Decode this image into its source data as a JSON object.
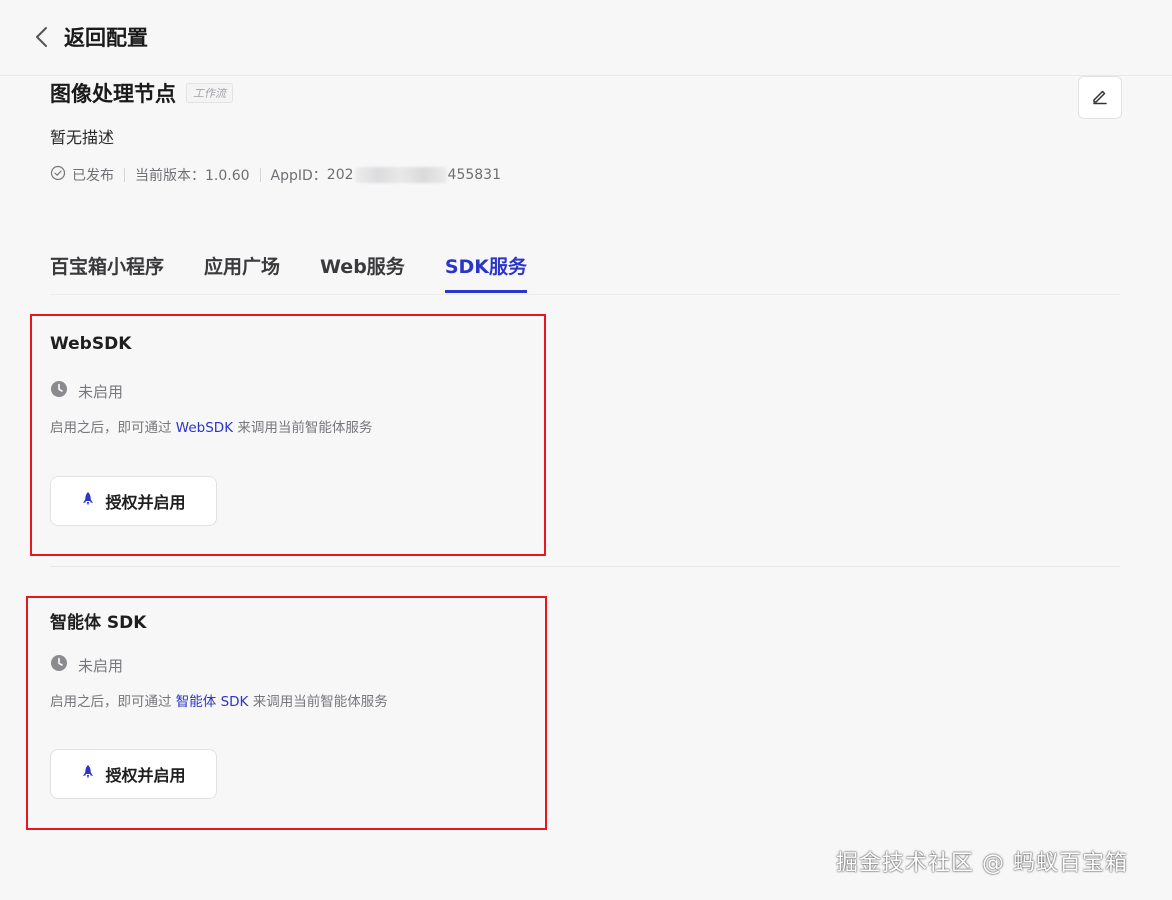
{
  "header": {
    "back_label": "返回配置"
  },
  "app": {
    "title": "图像处理节点",
    "tag": "工作流",
    "description": "暂无描述",
    "status": "已发布",
    "version_text": "当前版本：1.0.60",
    "appid_label": "AppID：",
    "appid_prefix": "202",
    "appid_suffix": "455831"
  },
  "tabs": [
    {
      "label": "百宝箱小程序",
      "active": false
    },
    {
      "label": "应用广场",
      "active": false
    },
    {
      "label": "Web服务",
      "active": false
    },
    {
      "label": "SDK服务",
      "active": true
    }
  ],
  "cards": [
    {
      "title": "WebSDK",
      "status": "未启用",
      "desc_prefix": "启用之后，即可通过 ",
      "desc_link": "WebSDK",
      "desc_suffix": " 来调用当前智能体服务",
      "button_label": "授权并启用"
    },
    {
      "title": "智能体 SDK",
      "status": "未启用",
      "desc_prefix": "启用之后，即可通过 ",
      "desc_link": "智能体 SDK",
      "desc_suffix": " 来调用当前智能体服务",
      "button_label": "授权并启用"
    }
  ],
  "watermark": "掘金技术社区 @ 蚂蚁百宝箱",
  "colors": {
    "accent": "#2b35c7",
    "highlight_border": "#e8171e",
    "background": "#f7f7f8"
  },
  "icons": {
    "back": "chevron-left-icon",
    "edit": "pencil-icon",
    "published": "check-circle-icon",
    "status": "clock-icon",
    "auth": "rocket-icon"
  }
}
